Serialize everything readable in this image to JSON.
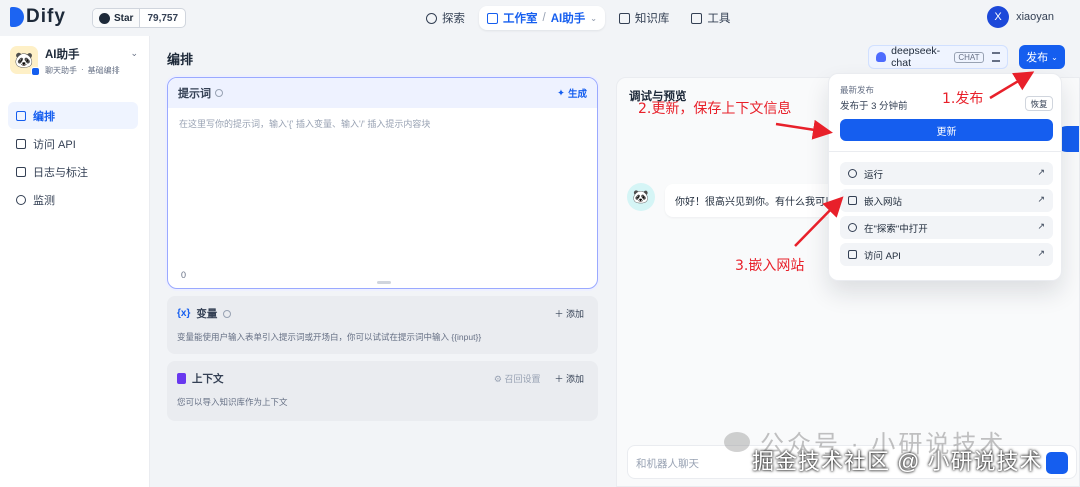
{
  "topbar": {
    "logo_text": "Dify",
    "star_label": "Star",
    "star_count": "79,757",
    "nav": [
      {
        "label": "探索"
      },
      {
        "label": "工作室",
        "sub": "AI助手"
      },
      {
        "label": "知识库"
      },
      {
        "label": "工具"
      }
    ],
    "user_initial": "X",
    "user_name": "xiaoyan"
  },
  "sidebar": {
    "app_name": "AI助手",
    "app_type": "聊天助手",
    "app_mode": "基础编排",
    "items": [
      {
        "label": "编排",
        "active": true
      },
      {
        "label": "访问 API"
      },
      {
        "label": "日志与标注"
      },
      {
        "label": "监测"
      }
    ]
  },
  "main": {
    "title": "编排",
    "model_name": "deepseek-chat",
    "model_tag": "CHAT",
    "publish_label": "发布"
  },
  "prompt": {
    "title": "提示词",
    "generate_label": "生成",
    "placeholder": "在这里写你的提示词，输入'{' 插入变量、输入'/' 插入提示内容块",
    "count": "0"
  },
  "variables": {
    "title": "变量",
    "add_label": "添加",
    "desc": "变量能使用户输入表单引入提示词或开场白，你可以试试在提示词中输入 {{input}}"
  },
  "context": {
    "title": "上下文",
    "settings_label": "召回设置",
    "add_label": "添加",
    "desc": "您可以导入知识库作为上下文"
  },
  "debug": {
    "title": "调试与预览",
    "greeting": "你好！很高兴见到你。有什么我可以",
    "input_placeholder": "和机器人聊天"
  },
  "publish_menu": {
    "latest_label": "最新发布",
    "published_time": "发布于 3 分钟前",
    "restore_label": "恢复",
    "update_label": "更新",
    "items": [
      {
        "label": "运行",
        "icon": "play-icon"
      },
      {
        "label": "嵌入网站",
        "icon": "embed-icon"
      },
      {
        "label": "在\"探索\"中打开",
        "icon": "compass-icon"
      },
      {
        "label": "访问 API",
        "icon": "api-icon"
      }
    ]
  },
  "annotations": {
    "step1": "1.发布",
    "step2": "2.更新，保存上下文信息",
    "step3": "3.嵌入网站",
    "color": "#e8202a"
  },
  "watermark": {
    "line1": "公众号 · 小研说技术",
    "line2": "掘金技术社区 @ 小研说技术"
  }
}
